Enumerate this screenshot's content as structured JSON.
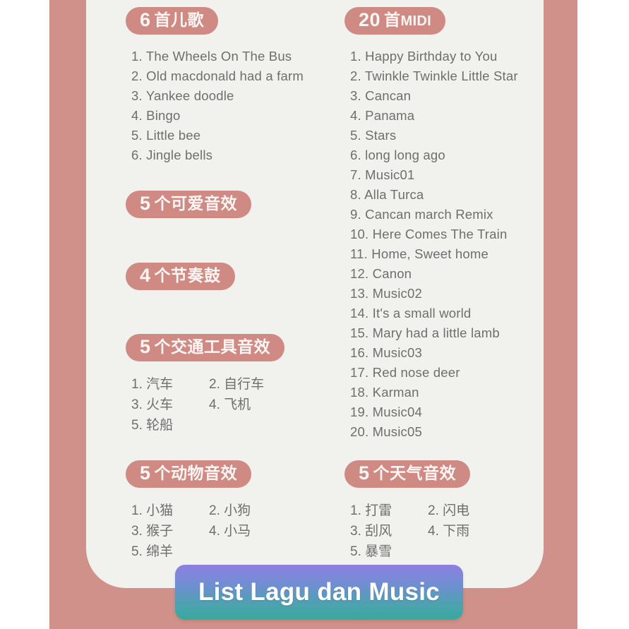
{
  "banner": {
    "title": "List Lagu dan Music"
  },
  "colors": {
    "badge_pink": "#cf8a83",
    "frame_rose": "#cf9189",
    "card_bg": "#f1f2ee",
    "text_gray": "#6e6e6e",
    "banner_gradient_start": "#8c80e2",
    "banner_gradient_end": "#3aa89f"
  },
  "sections": {
    "kids_songs": {
      "badge_num": "6",
      "badge_text": "首儿歌",
      "items": [
        "1. The Wheels On The Bus",
        "2. Old macdonald had a farm",
        "3. Yankee doodle",
        "4. Bingo",
        "5. Little bee",
        "6. Jingle bells"
      ]
    },
    "midi": {
      "badge_num": "20",
      "badge_text": "首",
      "badge_text_sm": "MIDI",
      "items": [
        "1. Happy Birthday to You",
        "2. Twinkle Twinkle Little Star",
        "3. Cancan",
        "4. Panama",
        "5. Stars",
        "6. long long ago",
        "7. Music01",
        "8. Alla Turca",
        "9. Cancan march Remix",
        "10. Here Comes The Train",
        "11. Home, Sweet home",
        "12. Canon",
        "13. Music02",
        "14. It's a small world",
        "15. Mary had a little lamb",
        "16. Music03",
        "17. Red nose deer",
        "18. Karman",
        "19. Music04",
        "20. Music05"
      ]
    },
    "cute_sounds": {
      "badge_num": "5",
      "badge_text": "个可爱音效",
      "items": []
    },
    "rhythm_drums": {
      "badge_num": "4",
      "badge_text": "个节奏鼓",
      "items": []
    },
    "transport_sounds": {
      "badge_num": "5",
      "badge_text": "个交通工具音效",
      "items": [
        "1. 汽车",
        "2. 自行车",
        "3. 火车",
        "4. 飞机",
        "5. 轮船"
      ]
    },
    "animal_sounds": {
      "badge_num": "5",
      "badge_text": "个动物音效",
      "items": [
        "1. 小猫",
        "2. 小狗",
        "3. 猴子",
        "4. 小马",
        "5. 绵羊"
      ]
    },
    "weather_sounds": {
      "badge_num": "5",
      "badge_text": "个天气音效",
      "items": [
        "1. 打雷",
        "2. 闪电",
        "3. 刮风",
        "4. 下雨",
        "5. 暴雪"
      ]
    }
  }
}
